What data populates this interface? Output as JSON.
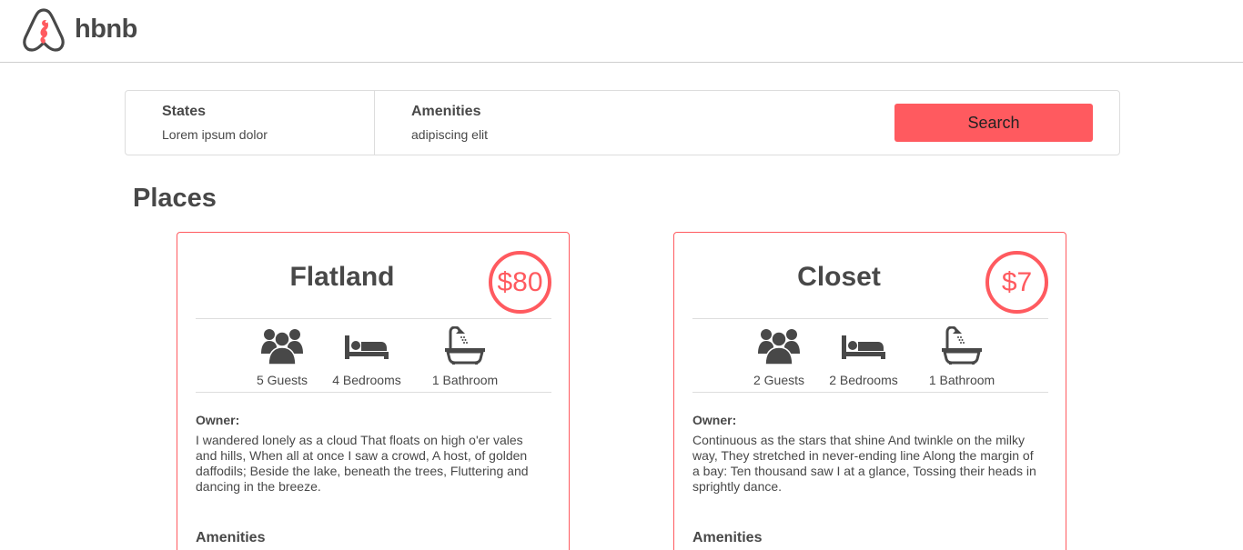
{
  "header": {
    "logo_text": "hbnb",
    "brand_color": "#FF5A5F"
  },
  "filters": {
    "states": {
      "title": "States",
      "value": "Lorem ipsum dolor"
    },
    "amenities": {
      "title": "Amenities",
      "value": "adipiscing elit"
    },
    "search_label": "Search"
  },
  "places": {
    "title": "Places",
    "items": [
      {
        "name": "Flatland",
        "price": "$80",
        "guests": "5 Guests",
        "bedrooms": "4 Bedrooms",
        "bathrooms": "1 Bathroom",
        "owner_label": "Owner:",
        "description": "I wandered lonely as a cloud That floats on high o'er vales and hills, When all at once I saw a crowd, A host, of golden daffodils; Beside the lake, beneath the trees, Fluttering and dancing in the breeze.",
        "amenities_label": "Amenities"
      },
      {
        "name": "Closet",
        "price": "$7",
        "guests": "2 Guests",
        "bedrooms": "2 Bedrooms",
        "bathrooms": "1 Bathroom",
        "owner_label": "Owner:",
        "description": "Continuous as the stars that shine And twinkle on the milky way, They stretched in never-ending line Along the margin of a bay: Ten thousand saw I at a glance, Tossing their heads in sprightly dance.",
        "amenities_label": "Amenities"
      }
    ]
  },
  "icons": {
    "logo": "airbnb-logo-icon",
    "guests": "group-icon",
    "bedrooms": "bed-icon",
    "bathrooms": "bathtub-icon"
  }
}
